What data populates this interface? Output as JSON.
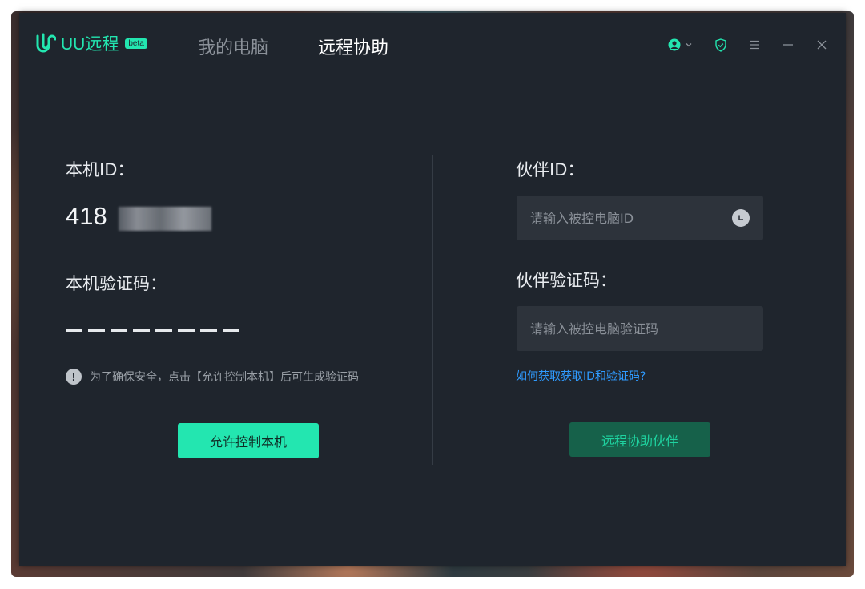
{
  "app": {
    "name": "UU远程",
    "badge": "beta",
    "accent_color": "#23e6b0",
    "logo_icon": "uu-logo-icon"
  },
  "nav": {
    "tabs": [
      {
        "label": "我的电脑",
        "active": false
      },
      {
        "label": "远程协助",
        "active": true
      }
    ]
  },
  "titlebar_icons": [
    "account-icon",
    "chevron-down-icon",
    "shield-check-icon",
    "menu-icon",
    "minimize-icon",
    "close-icon"
  ],
  "local": {
    "id_label": "本机ID：",
    "id_value": "418",
    "code_label": "本机验证码：",
    "code_placeholder_dashes": 8,
    "notice": "为了确保安全，点击【允许控制本机】后可生成验证码",
    "allow_button": "允许控制本机"
  },
  "partner": {
    "id_label": "伙伴ID：",
    "id_placeholder": "请输入被控电脑ID",
    "code_label": "伙伴验证码：",
    "code_placeholder": "请输入被控电脑验证码",
    "help_link": "如何获取获取ID和验证码?",
    "assist_button": "远程协助伙伴"
  }
}
